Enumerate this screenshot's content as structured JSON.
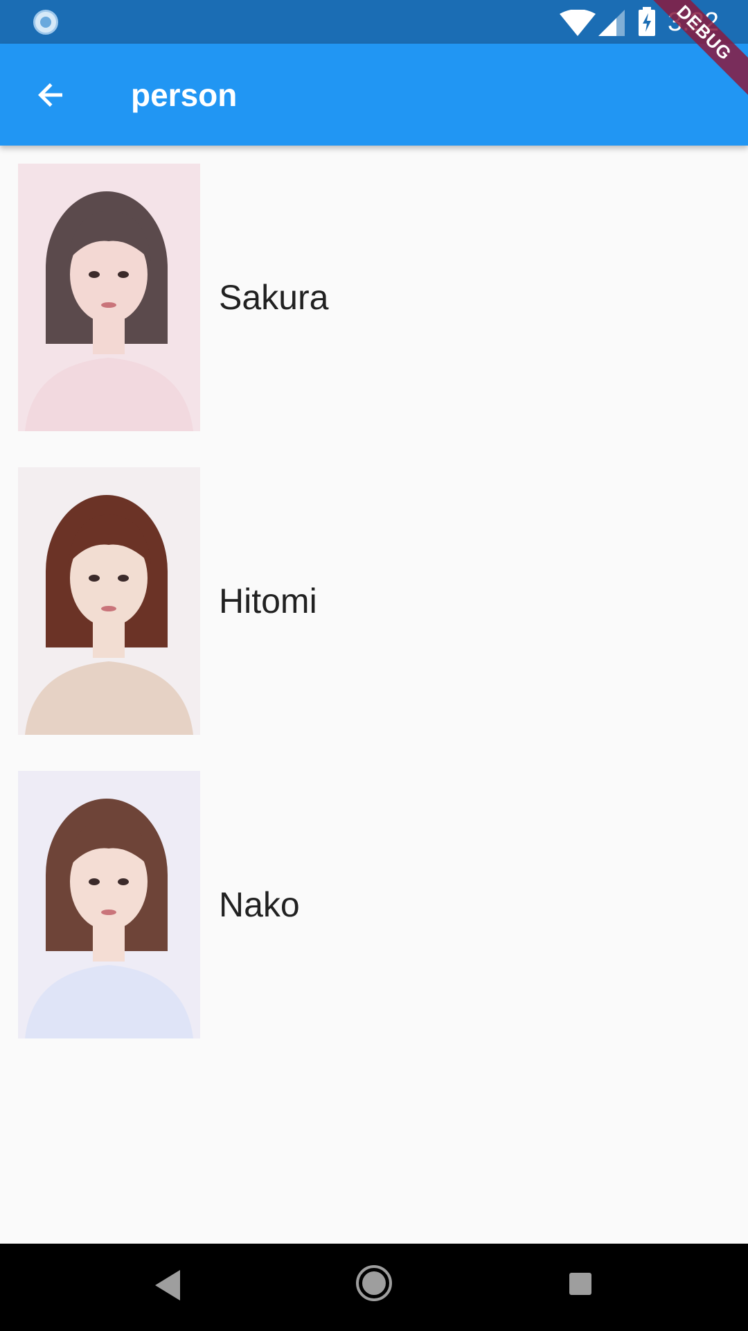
{
  "status_bar": {
    "time": "3:22",
    "icons": [
      "sync-icon",
      "wifi-icon",
      "signal-icon",
      "battery-charging-icon"
    ]
  },
  "app_bar": {
    "title": "person",
    "back_icon": "arrow-back-icon"
  },
  "debug_banner": {
    "label": "DEBUG"
  },
  "people": [
    {
      "name": "Sakura",
      "photo": "portrait-photo",
      "palette": {
        "bg": "#f4e3e8",
        "hair": "#5b4a4c",
        "skin": "#f3d8d3",
        "top": "#f2d9df"
      }
    },
    {
      "name": "Hitomi",
      "photo": "portrait-photo",
      "palette": {
        "bg": "#f3eef0",
        "hair": "#6b3326",
        "skin": "#f2ddd2",
        "top": "#e6d2c5"
      }
    },
    {
      "name": "Nako",
      "photo": "portrait-photo",
      "palette": {
        "bg": "#eeecf6",
        "hair": "#6e4438",
        "skin": "#f4ddd4",
        "top": "#dfe4f7"
      }
    }
  ],
  "nav_bar": {
    "icons": [
      "nav-back-icon",
      "nav-home-icon",
      "nav-recent-icon"
    ]
  },
  "colors": {
    "status_bar": "#1b6db4",
    "app_bar": "#2196f3",
    "background": "#fafafa",
    "text": "#212121"
  }
}
